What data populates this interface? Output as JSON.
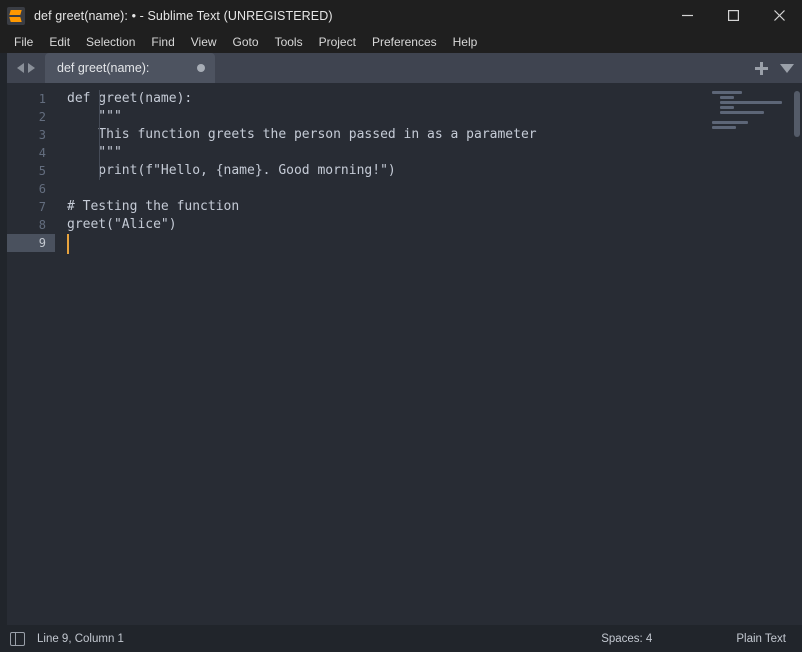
{
  "window": {
    "title": "def greet(name): • - Sublime Text (UNREGISTERED)",
    "app_icon": "sublime-text-logo-icon",
    "controls": {
      "minimize": "minimize-icon",
      "maximize": "maximize-icon",
      "close": "close-icon"
    }
  },
  "menubar": {
    "items": [
      {
        "label": "File"
      },
      {
        "label": "Edit"
      },
      {
        "label": "Selection"
      },
      {
        "label": "Find"
      },
      {
        "label": "View"
      },
      {
        "label": "Goto"
      },
      {
        "label": "Tools"
      },
      {
        "label": "Project"
      },
      {
        "label": "Preferences"
      },
      {
        "label": "Help"
      }
    ]
  },
  "tabbar": {
    "nav_back_icon": "chevron-left-icon",
    "nav_forward_icon": "chevron-right-icon",
    "tabs": [
      {
        "label": "def greet(name):",
        "dirty": true,
        "active": true
      }
    ],
    "new_tab_icon": "plus-icon",
    "tab_list_icon": "chevron-down-icon"
  },
  "editor": {
    "line_numbers": [
      "1",
      "2",
      "3",
      "4",
      "5",
      "6",
      "7",
      "8",
      "9"
    ],
    "active_line": 9,
    "lines": [
      "def greet(name):",
      "    \"\"\"",
      "    This function greets the person passed in as a parameter",
      "    \"\"\"",
      "    print(f\"Hello, {name}. Good morning!\")",
      "",
      "# Testing the function",
      "greet(\"Alice\")",
      ""
    ],
    "cursor_color": "#e8a33d",
    "background": "#282c34",
    "text_color": "#c5cbd6"
  },
  "statusbar": {
    "sidebar_toggle_icon": "sidebar-toggle-icon",
    "position": "Line 9, Column 1",
    "indentation": "Spaces: 4",
    "syntax": "Plain Text"
  }
}
